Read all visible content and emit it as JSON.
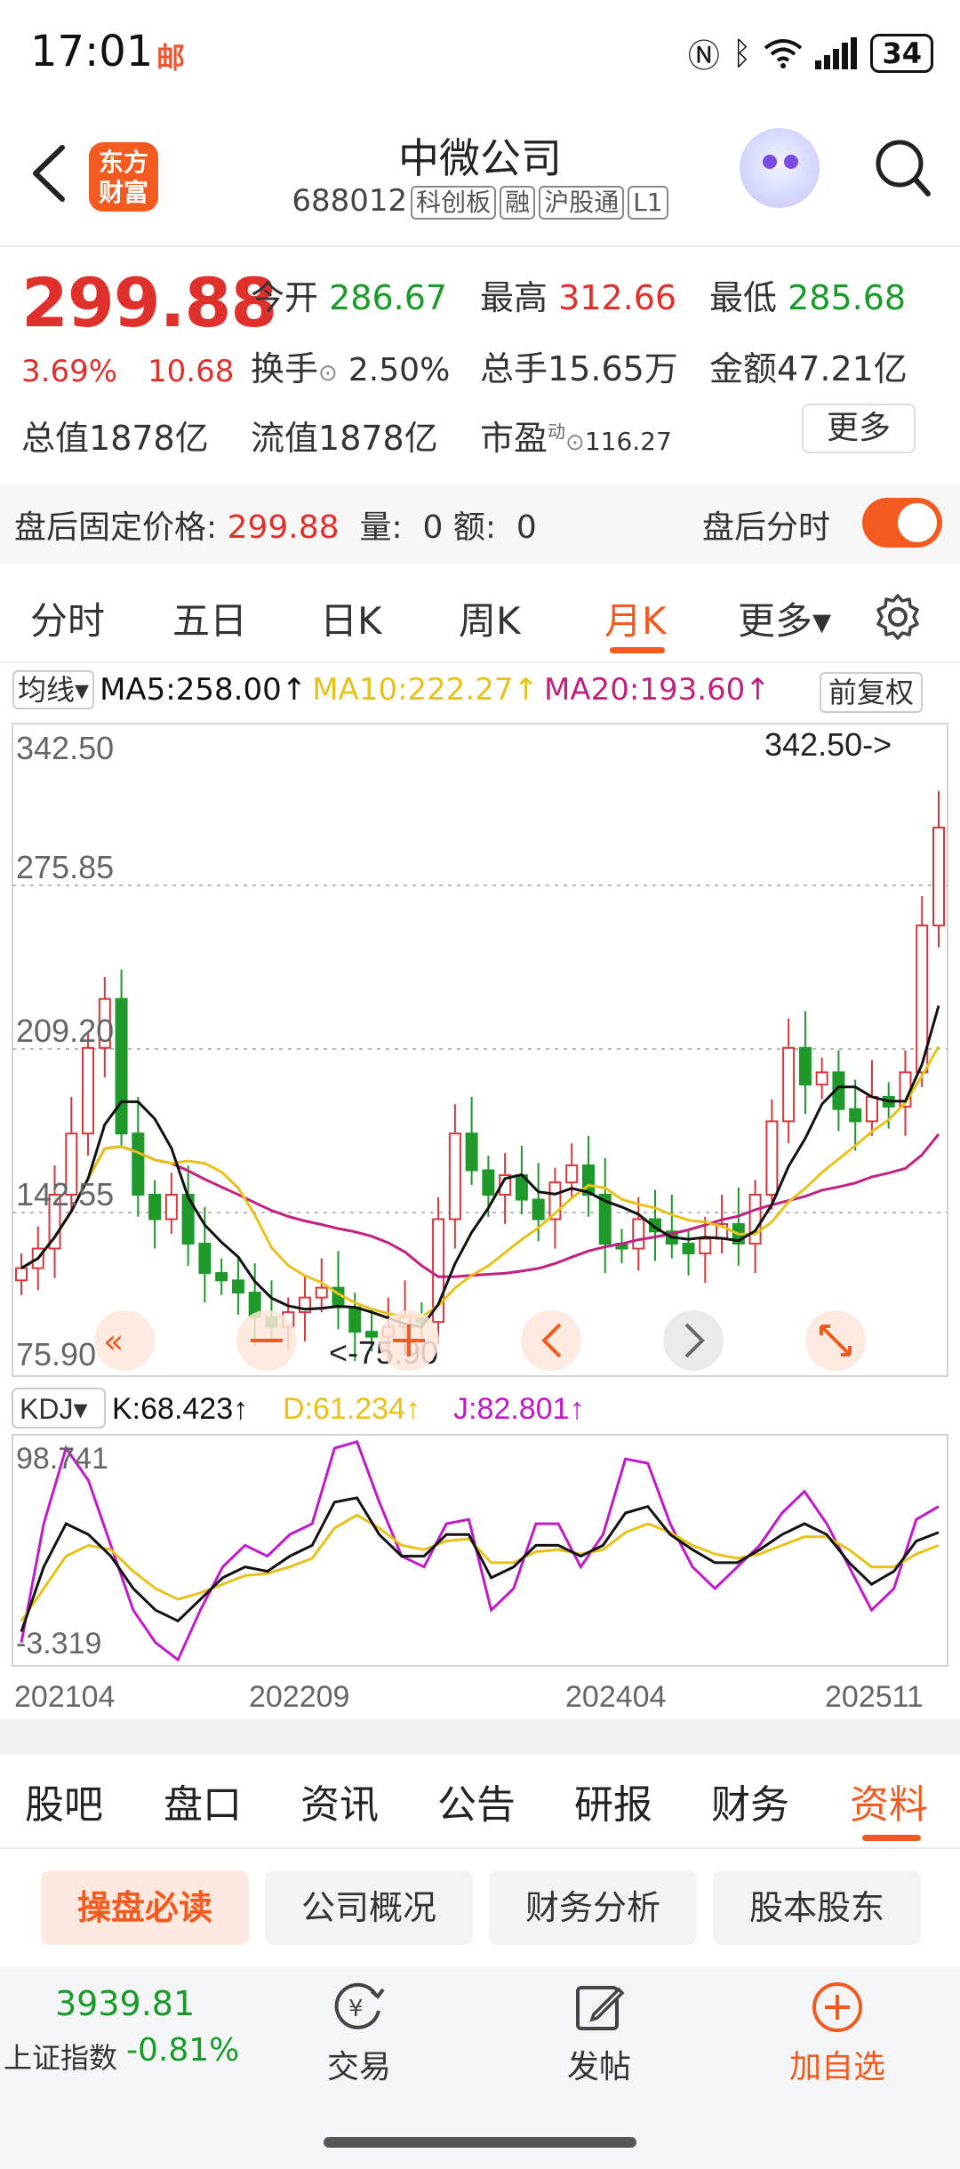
{
  "status": {
    "time": "17:01",
    "mail_icon": "邮",
    "battery": "34"
  },
  "header": {
    "logo_line1": "东方",
    "logo_line2": "财富",
    "title": "中微公司",
    "code": "688012",
    "tags": [
      "科创板",
      "融",
      "沪股通",
      "L1"
    ]
  },
  "quote": {
    "price": "299.88",
    "pct": "3.69%",
    "change": "10.68",
    "open_label": "今开",
    "open": "286.67",
    "high_label": "最高",
    "high": "312.66",
    "low_label": "最低",
    "low": "285.68",
    "turnover_label": "换手",
    "turnover": "2.50%",
    "volume_label": "总手",
    "volume": "15.65万",
    "amount_label": "金额",
    "amount": "47.21亿",
    "mktcap_label": "总值",
    "mktcap": "1878亿",
    "float_label": "流值",
    "float": "1878亿",
    "pe_label": "市盈",
    "pe_sup": "动",
    "pe": "116.27",
    "more": "更多"
  },
  "after_hours": {
    "label": "盘后固定价格:",
    "price": "299.88",
    "vol_label": "量:",
    "vol": "0",
    "amt_label": "额:",
    "amt": "0",
    "toggle_label": "盘后分时",
    "toggle_on": true
  },
  "tabs": [
    "分时",
    "五日",
    "日K",
    "周K",
    "月K",
    "更多▾"
  ],
  "active_tab": "月K",
  "ma": {
    "selector": "均线▾",
    "ma5": "MA5:258.00↑",
    "ma10": "MA10:222.27↑",
    "ma20": "MA20:193.60↑",
    "adjust": "前复权",
    "colors": {
      "ma5": "#111111",
      "ma10": "#e8c21a",
      "ma20": "#c2217f"
    }
  },
  "kdj": {
    "selector": "KDJ▾",
    "k": "K:68.423↑",
    "d": "D:61.234↑",
    "j": "J:82.801↑",
    "colors": {
      "k": "#111111",
      "d": "#e8c21a",
      "j": "#c21acb"
    }
  },
  "chart_data": {
    "type": "candlestick",
    "price_axis": {
      "max_label": "342.50",
      "upper_label": "275.85",
      "mid_label": "209.20",
      "lower_label": "142.55",
      "min_label": "75.90"
    },
    "max_marker": "342.50->",
    "min_marker": "<-75.90",
    "kdj_axis": {
      "max_label": "98.741",
      "min_label": "-3.319"
    },
    "x_labels": [
      "202104",
      "202209",
      "202404",
      "202511"
    ],
    "series": [
      {
        "name": "MA5",
        "latest": 258.0
      },
      {
        "name": "MA10",
        "latest": 222.27
      },
      {
        "name": "MA20",
        "latest": 193.6
      }
    ]
  },
  "bottom_tabs": [
    "股吧",
    "盘口",
    "资讯",
    "公告",
    "研报",
    "财务",
    "资料"
  ],
  "active_bottom_tab": "资料",
  "chips": [
    "操盘必读",
    "公司概况",
    "财务分析",
    "股本股东"
  ],
  "active_chip": "操盘必读",
  "bottom_bar": {
    "index_value": "3939.81",
    "index_name": "上证指数",
    "index_change": "-0.81%",
    "trade": "交易",
    "post": "发帖",
    "add_watch": "加自选"
  }
}
